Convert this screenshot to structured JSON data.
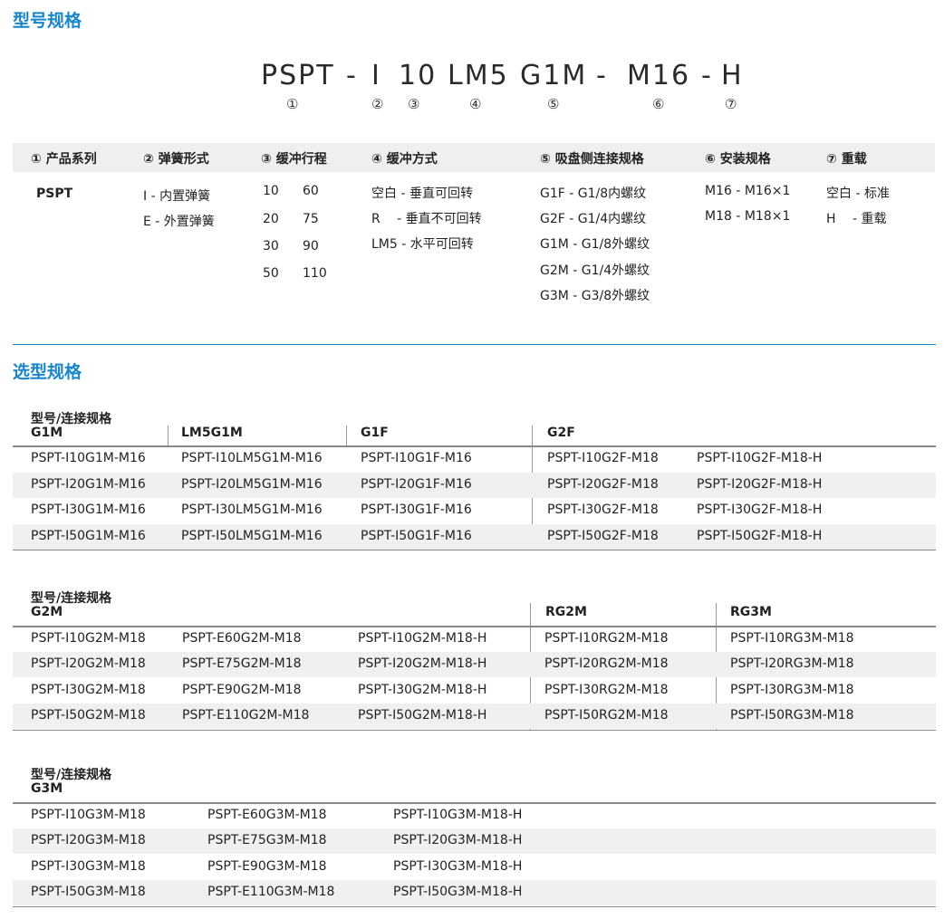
{
  "sections": {
    "model_spec_title": "型号规格",
    "selection_title": "选型规格"
  },
  "model_code": {
    "parts": [
      "PSPT",
      "-",
      "I",
      "10",
      "LM5",
      "G1M",
      "-",
      "M16",
      "-",
      "H"
    ],
    "markers": [
      "①",
      "②",
      "③",
      "④",
      "⑤",
      "⑥",
      "⑦"
    ]
  },
  "spec": {
    "headers": [
      "① 产品系列",
      "② 弹簧形式",
      "③ 缓冲行程",
      "④ 缓冲方式",
      "⑤ 吸盘侧连接规格",
      "⑥ 安装规格",
      "⑦ 重载"
    ],
    "series": [
      "PSPT"
    ],
    "spring": [
      "I - 内置弹簧",
      "E - 外置弹簧"
    ],
    "stroke": [
      [
        "10",
        "60"
      ],
      [
        "20",
        "75"
      ],
      [
        "30",
        "90"
      ],
      [
        "50",
        "110"
      ]
    ],
    "buffer": [
      "空白 - 垂直可回转",
      "R　 - 垂直不可回转",
      "LM5 - 水平可回转"
    ],
    "connect": [
      "G1F - G1/8内螺纹",
      "G2F - G1/4内螺纹",
      "G1M - G1/8外螺纹",
      "G2M - G1/4外螺纹",
      "G3M - G3/8外螺纹"
    ],
    "mount": [
      "M16 - M16×1",
      "M18 - M18×1"
    ],
    "heavy": [
      "空白 - 标准",
      "H　 - 重载"
    ]
  },
  "table1": {
    "title": "型号/连接规格",
    "headers": [
      "G1M",
      "LM5G1M",
      "G1F",
      "G2F"
    ],
    "rows": [
      [
        "PSPT-I10G1M-M16",
        "PSPT-I10LM5G1M-M16",
        "PSPT-I10G1F-M16",
        "PSPT-I10G2F-M18",
        "PSPT-I10G2F-M18-H"
      ],
      [
        "PSPT-I20G1M-M16",
        "PSPT-I20LM5G1M-M16",
        "PSPT-I20G1F-M16",
        "PSPT-I20G2F-M18",
        "PSPT-I20G2F-M18-H"
      ],
      [
        "PSPT-I30G1M-M16",
        "PSPT-I30LM5G1M-M16",
        "PSPT-I30G1F-M16",
        "PSPT-I30G2F-M18",
        "PSPT-I30G2F-M18-H"
      ],
      [
        "PSPT-I50G1M-M16",
        "PSPT-I50LM5G1M-M16",
        "PSPT-I50G1F-M16",
        "PSPT-I50G2F-M18",
        "PSPT-I50G2F-M18-H"
      ]
    ]
  },
  "table2": {
    "title": "型号/连接规格",
    "headers": [
      "G2M",
      "RG2M",
      "RG3M"
    ],
    "rows": [
      [
        "PSPT-I10G2M-M18",
        "PSPT-E60G2M-M18",
        "PSPT-I10G2M-M18-H",
        "PSPT-I10RG2M-M18",
        "PSPT-I10RG3M-M18"
      ],
      [
        "PSPT-I20G2M-M18",
        "PSPT-E75G2M-M18",
        "PSPT-I20G2M-M18-H",
        "PSPT-I20RG2M-M18",
        "PSPT-I20RG3M-M18"
      ],
      [
        "PSPT-I30G2M-M18",
        "PSPT-E90G2M-M18",
        "PSPT-I30G2M-M18-H",
        "PSPT-I30RG2M-M18",
        "PSPT-I30RG3M-M18"
      ],
      [
        "PSPT-I50G2M-M18",
        "PSPT-E110G2M-M18",
        "PSPT-I50G2M-M18-H",
        "PSPT-I50RG2M-M18",
        "PSPT-I50RG3M-M18"
      ]
    ]
  },
  "table3": {
    "title": "型号/连接规格",
    "headers": [
      "G3M"
    ],
    "rows": [
      [
        "PSPT-I10G3M-M18",
        "PSPT-E60G3M-M18",
        "PSPT-I10G3M-M18-H"
      ],
      [
        "PSPT-I20G3M-M18",
        "PSPT-E75G3M-M18",
        "PSPT-I20G3M-M18-H"
      ],
      [
        "PSPT-I30G3M-M18",
        "PSPT-E90G3M-M18",
        "PSPT-I30G3M-M18-H"
      ],
      [
        "PSPT-I50G3M-M18",
        "PSPT-E110G3M-M18",
        "PSPT-I50G3M-M18-H"
      ]
    ]
  }
}
